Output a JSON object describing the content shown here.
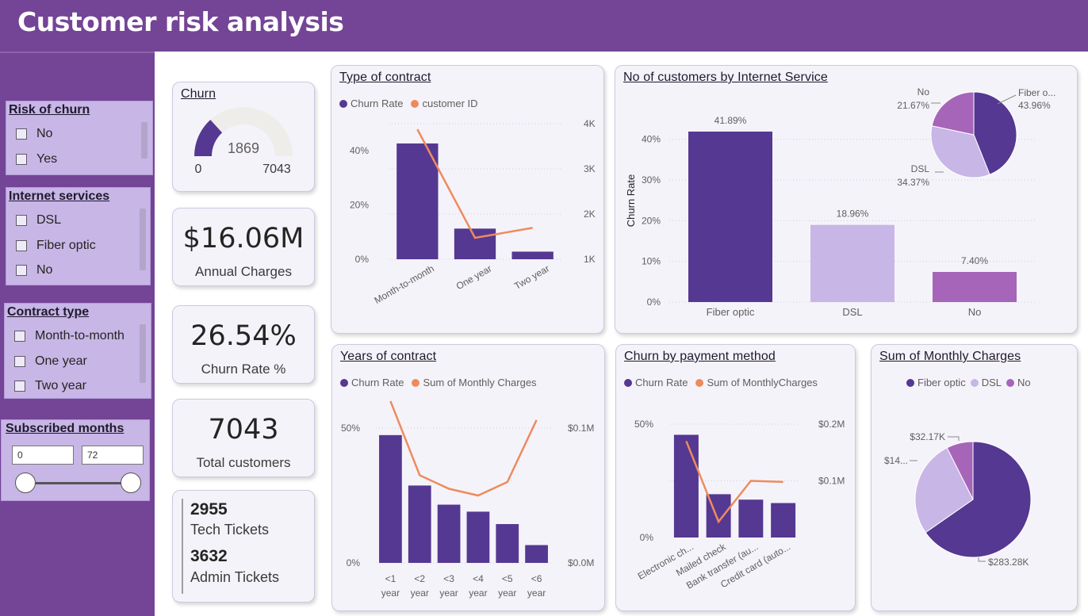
{
  "header": {
    "title": "Customer risk analysis"
  },
  "colors": {
    "purple_dark": "#553891",
    "purple_light": "#c8b6e6",
    "purple_mid": "#a665b8",
    "orange": "#ee8b5e",
    "header_bg": "#744496"
  },
  "slicers": {
    "risk": {
      "title": "Risk of churn",
      "items": [
        "No",
        "Yes"
      ]
    },
    "internet": {
      "title": "Internet services",
      "items": [
        "DSL",
        "Fiber optic",
        "No"
      ]
    },
    "contract": {
      "title": "Contract type",
      "items": [
        "Month-to-month",
        "One year",
        "Two year"
      ]
    },
    "months": {
      "title": "Subscribed months",
      "min": "0",
      "max": "72"
    }
  },
  "kpis": {
    "churn": {
      "title": "Churn",
      "value": "1869",
      "min": "0",
      "max": "7043",
      "fraction": 0.2654
    },
    "annual": {
      "value": "$16.06M",
      "label": "Annual Charges"
    },
    "rate": {
      "value": "26.54%",
      "label": "Churn Rate %"
    },
    "total": {
      "value": "7043",
      "label": "Total customers"
    },
    "tickets": {
      "tech_value": "2955",
      "tech_label": "Tech Tickets",
      "admin_value": "3632",
      "admin_label": "Admin Tickets"
    }
  },
  "chart_data": [
    {
      "id": "contract",
      "type": "bar+line",
      "title": "Type of contract",
      "legend": [
        "Churn Rate",
        "customer ID"
      ],
      "categories": [
        "Month-to-month",
        "One year",
        "Two year"
      ],
      "series": [
        {
          "name": "Churn Rate",
          "axis": "left",
          "values": [
            42.7,
            11.3,
            2.8
          ]
        },
        {
          "name": "customer ID",
          "axis": "right",
          "values": [
            3875,
            1473,
            1695
          ]
        }
      ],
      "y_left": {
        "ticks": [
          "0%",
          "20%",
          "40%"
        ],
        "range": [
          0,
          50
        ]
      },
      "y_right": {
        "ticks": [
          "1K",
          "2K",
          "3K",
          "4K"
        ],
        "range": [
          1000,
          4000
        ]
      }
    },
    {
      "id": "internet",
      "type": "bar+pie",
      "title": "No of customers by Internet Service",
      "ylabel": "Churn Rate",
      "categories": [
        "Fiber optic",
        "DSL",
        "No"
      ],
      "values": [
        41.89,
        18.96,
        7.4
      ],
      "labels": [
        "41.89%",
        "18.96%",
        "7.40%"
      ],
      "y_ticks": [
        "0%",
        "10%",
        "20%",
        "30%",
        "40%"
      ],
      "ylim": [
        0,
        45
      ],
      "pie": {
        "slices": [
          {
            "name": "Fiber o...",
            "label": "43.96%",
            "value": 43.96
          },
          {
            "name": "DSL",
            "label": "34.37%",
            "value": 34.37
          },
          {
            "name": "No",
            "label": "21.67%",
            "value": 21.67
          }
        ]
      }
    },
    {
      "id": "years",
      "type": "bar+line",
      "title": "Years of contract",
      "legend": [
        "Churn Rate",
        "Sum of Monthly Charges"
      ],
      "categories": [
        [
          "<1",
          "year"
        ],
        [
          "<2",
          "year"
        ],
        [
          "<3",
          "year"
        ],
        [
          "<4",
          "year"
        ],
        [
          "<5",
          "year"
        ],
        [
          "<6",
          "year"
        ]
      ],
      "series": [
        {
          "name": "Churn Rate",
          "axis": "left",
          "values": [
            47.4,
            28.7,
            21.6,
            19.0,
            14.4,
            6.6
          ]
        },
        {
          "name": "Sum of Monthly Charges",
          "axis": "right",
          "values": [
            0.12,
            0.065,
            0.055,
            0.05,
            0.06,
            0.106
          ]
        }
      ],
      "y_left": {
        "ticks": [
          "0%",
          "50%"
        ],
        "range": [
          0,
          50
        ]
      },
      "y_right": {
        "ticks": [
          "$0.0M",
          "$0.1M"
        ],
        "range": [
          0,
          0.1
        ]
      }
    },
    {
      "id": "payment",
      "type": "bar+line",
      "title": "Churn by payment method",
      "legend": [
        "Churn Rate",
        "Sum of MonthlyCharges"
      ],
      "categories": [
        "Electronic ch...",
        "Mailed check",
        "Bank transfer (au...",
        "Credit card (auto..."
      ],
      "series": [
        {
          "name": "Churn Rate",
          "axis": "left",
          "values": [
            45.3,
            19.1,
            16.7,
            15.2
          ]
        },
        {
          "name": "Sum of MonthlyCharges",
          "axis": "right",
          "values": [
            0.17,
            0.028,
            0.1,
            0.098
          ]
        }
      ],
      "y_left": {
        "ticks": [
          "0%",
          "50%"
        ],
        "range": [
          0,
          50
        ]
      },
      "y_right": {
        "ticks": [
          "$0.1M",
          "$0.2M"
        ],
        "range": [
          0,
          0.2
        ]
      }
    },
    {
      "id": "monthly",
      "type": "pie",
      "title": "Sum of Monthly Charges",
      "legend": [
        "Fiber optic",
        "DSL",
        "No"
      ],
      "slices": [
        {
          "name": "Fiber optic",
          "label": "$283.28K",
          "value": 283.28
        },
        {
          "name": "DSL",
          "label": "$14...",
          "value": 118.2
        },
        {
          "name": "No",
          "label": "$32.17K",
          "value": 32.17
        }
      ]
    }
  ]
}
